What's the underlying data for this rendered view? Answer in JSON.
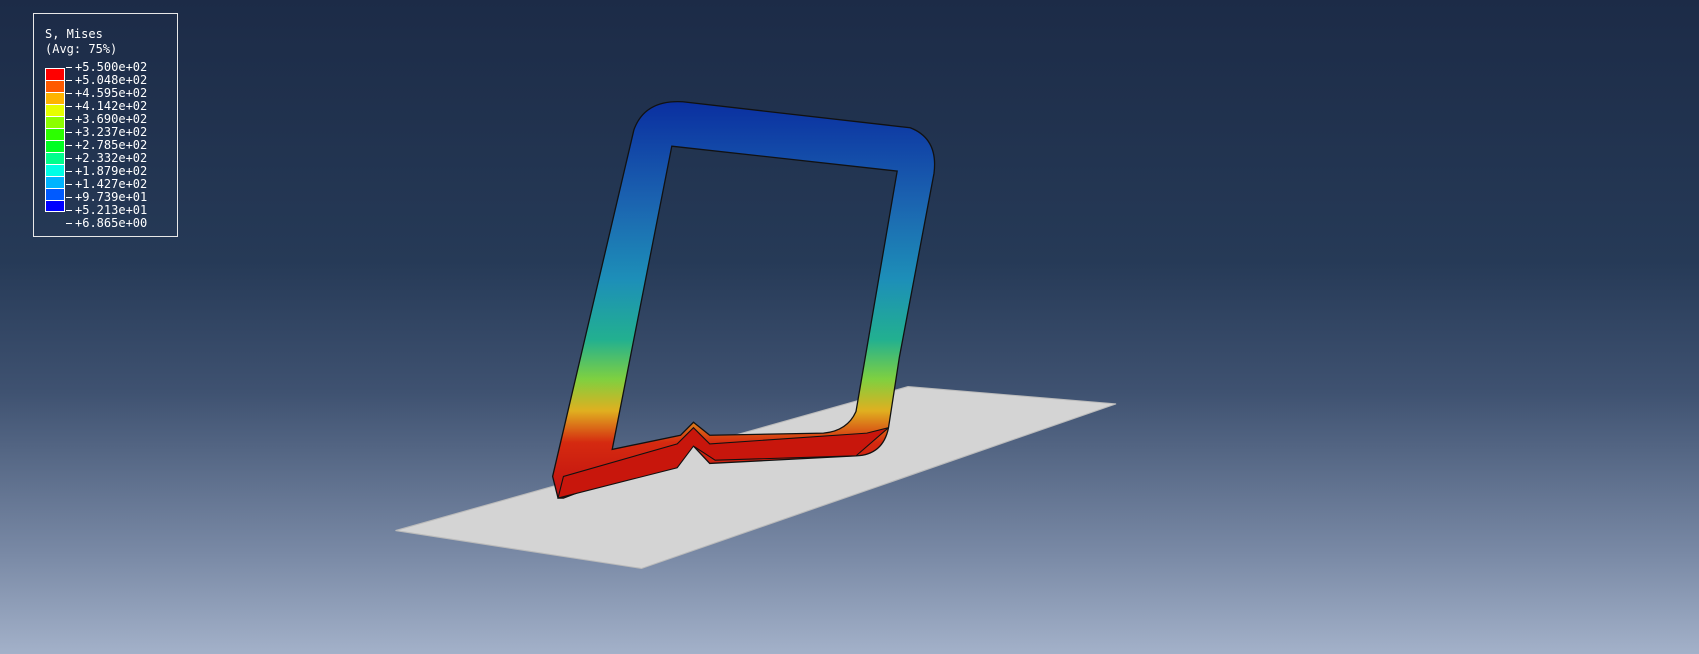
{
  "legend": {
    "title": "S, Mises",
    "subtitle": "(Avg: 75%)",
    "values": [
      "+5.500e+02",
      "+5.048e+02",
      "+4.595e+02",
      "+4.142e+02",
      "+3.690e+02",
      "+3.237e+02",
      "+2.785e+02",
      "+2.332e+02",
      "+1.879e+02",
      "+1.427e+02",
      "+9.739e+01",
      "+5.213e+01",
      "+6.865e+00"
    ],
    "colors": [
      "#ff0000",
      "#ff5a00",
      "#ffb400",
      "#e6ff00",
      "#8cff00",
      "#2cff00",
      "#00ff22",
      "#00ff8c",
      "#00ffe6",
      "#00b4ff",
      "#005aff",
      "#0000ff"
    ]
  }
}
